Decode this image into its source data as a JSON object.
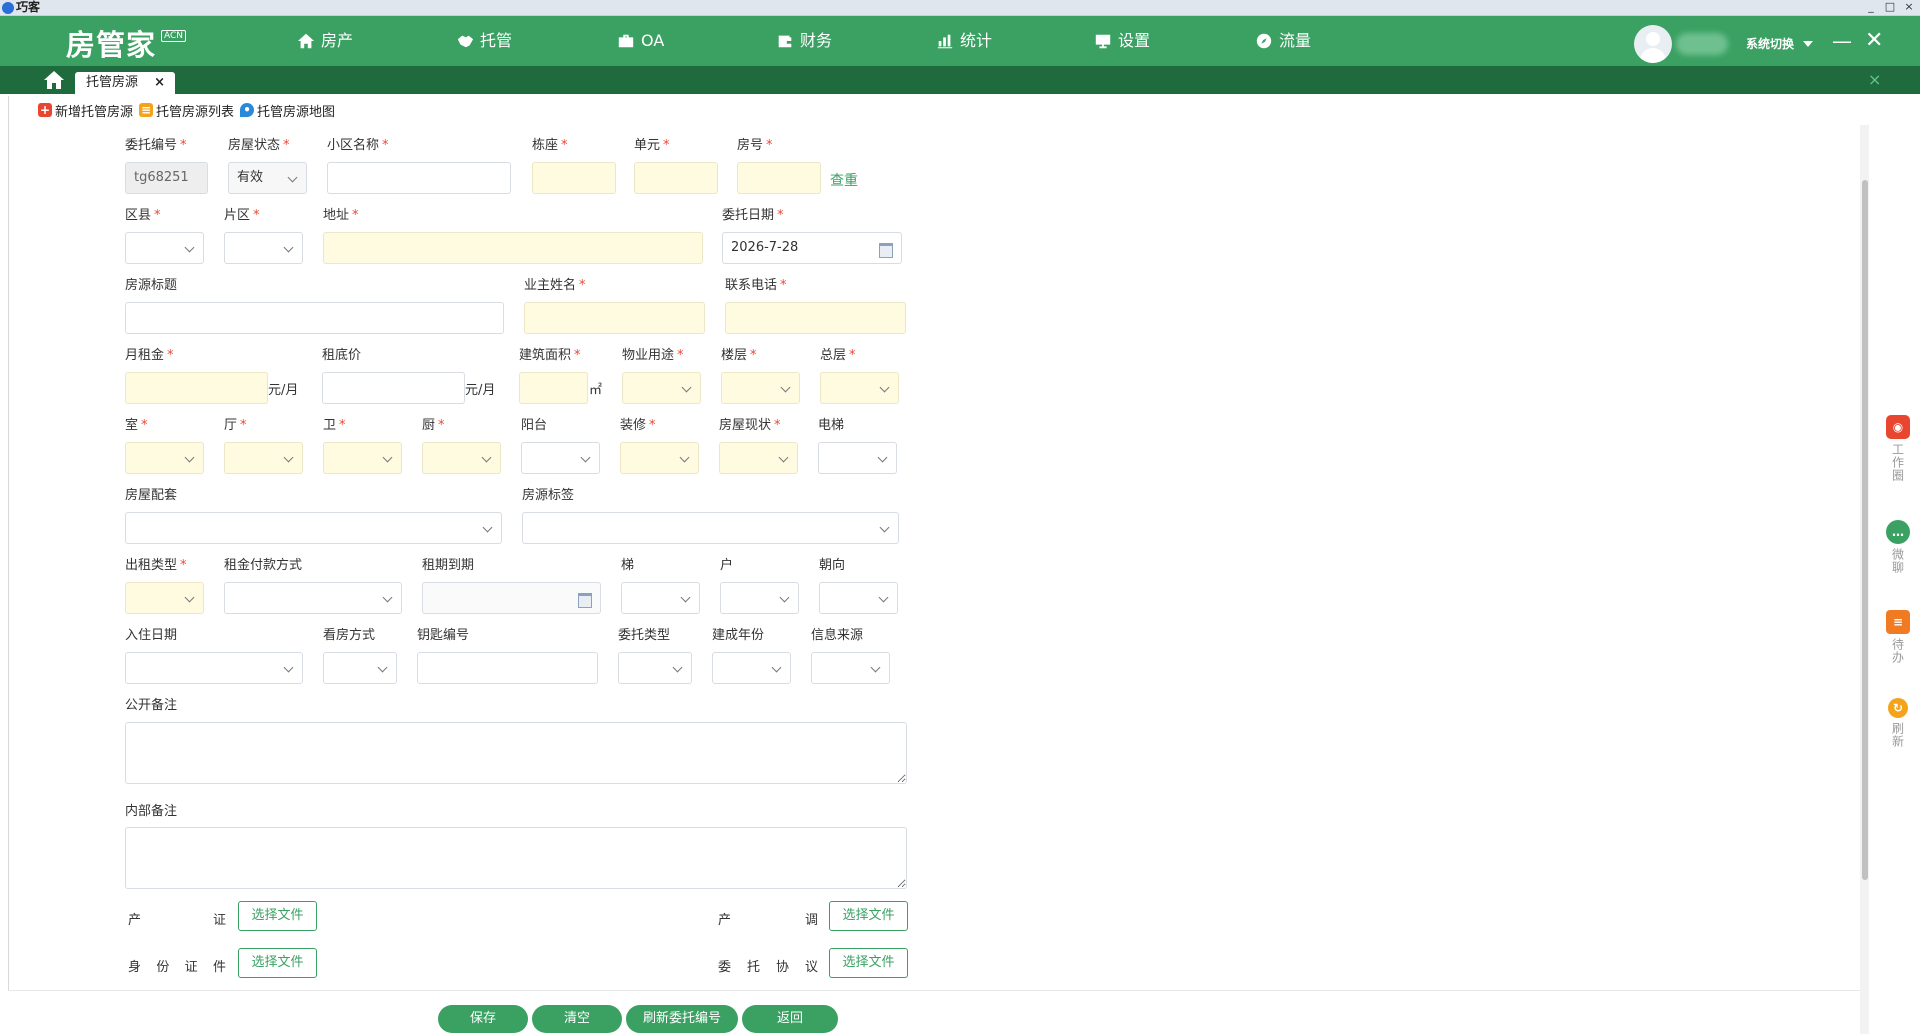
{
  "window": {
    "title": "巧客",
    "controls": [
      "_",
      "□",
      "×"
    ]
  },
  "brand": {
    "name": "房管家",
    "badge": "ACN"
  },
  "nav": [
    {
      "label": "房产",
      "icon": "home-icon"
    },
    {
      "label": "托管",
      "icon": "handshake-icon"
    },
    {
      "label": "OA",
      "icon": "briefcase-icon"
    },
    {
      "label": "财务",
      "icon": "wallet-icon"
    },
    {
      "label": "统计",
      "icon": "chart-icon"
    },
    {
      "label": "设置",
      "icon": "monitor-icon"
    },
    {
      "label": "流量",
      "icon": "compass-icon"
    }
  ],
  "user": {
    "switch_label": "系统切换",
    "minimize": "—",
    "close": "✕"
  },
  "tabs": {
    "active": "托管房源",
    "close": "×",
    "bar_close": "×"
  },
  "toolbar": {
    "add": "新增托管房源",
    "list": "托管房源列表",
    "map": "托管房源地图"
  },
  "form": {
    "entrust_no": {
      "label": "委托编号",
      "value": "tg68251"
    },
    "status": {
      "label": "房屋状态",
      "value": "有效"
    },
    "community": {
      "label": "小区名称",
      "value": ""
    },
    "building": {
      "label": "栋座",
      "value": ""
    },
    "unit": {
      "label": "单元",
      "value": ""
    },
    "room_no": {
      "label": "房号",
      "value": ""
    },
    "check_dup": "查重",
    "district": {
      "label": "区县"
    },
    "area": {
      "label": "片区"
    },
    "address": {
      "label": "地址"
    },
    "entrust_date": {
      "label": "委托日期",
      "value": "2026-7-28"
    },
    "title": {
      "label": "房源标题"
    },
    "owner": {
      "label": "业主姓名"
    },
    "phone": {
      "label": "联系电话"
    },
    "rent": {
      "label": "月租金",
      "unit": "元/月"
    },
    "min_rent": {
      "label": "租底价",
      "unit": "元/月"
    },
    "build_area": {
      "label": "建筑面积",
      "unit": "㎡"
    },
    "usage": {
      "label": "物业用途"
    },
    "floor": {
      "label": "楼层"
    },
    "total_floor": {
      "label": "总层"
    },
    "rooms": {
      "label": "室"
    },
    "halls": {
      "label": "厅"
    },
    "baths": {
      "label": "卫"
    },
    "kitchens": {
      "label": "厨"
    },
    "balcony": {
      "label": "阳台"
    },
    "decoration": {
      "label": "装修"
    },
    "condition": {
      "label": "房屋现状"
    },
    "elevator": {
      "label": "电梯"
    },
    "facilities": {
      "label": "房屋配套"
    },
    "tags": {
      "label": "房源标签"
    },
    "rent_type": {
      "label": "出租类型"
    },
    "pay_method": {
      "label": "租金付款方式"
    },
    "lease_end": {
      "label": "租期到期"
    },
    "stairs": {
      "label": "梯"
    },
    "households": {
      "label": "户"
    },
    "orientation": {
      "label": "朝向"
    },
    "move_in": {
      "label": "入住日期"
    },
    "viewing": {
      "label": "看房方式"
    },
    "key_no": {
      "label": "钥匙编号"
    },
    "entrust_type": {
      "label": "委托类型"
    },
    "built_year": {
      "label": "建成年份"
    },
    "source": {
      "label": "信息来源"
    },
    "public_note": {
      "label": "公开备注"
    },
    "internal_note": {
      "label": "内部备注"
    },
    "property_cert": {
      "label_l": "产",
      "label_r": "证"
    },
    "property_survey": {
      "label_l": "产",
      "label_r": "调"
    },
    "id_doc": {
      "chars": [
        "身",
        "份",
        "证",
        "件"
      ]
    },
    "entrust_agreement": {
      "chars": [
        "委",
        "托",
        "协",
        "议"
      ]
    },
    "choose_file": "选择文件",
    "required_mark": "*"
  },
  "actions": {
    "save": "保存",
    "clear": "清空",
    "refresh_no": "刷新委托编号",
    "back": "返回"
  },
  "side_tools": [
    {
      "label": "工作圈",
      "icon": "camera-icon",
      "color": "#e8462f"
    },
    {
      "label": "微聊",
      "icon": "chat-icon",
      "color": "#3aa163"
    },
    {
      "label": "待办",
      "icon": "todo-icon",
      "color": "#f07b22"
    },
    {
      "label": "刷新",
      "icon": "refresh-icon",
      "color": "#f3a41a"
    }
  ],
  "colors": {
    "primary": "#3aa163",
    "dark": "#1f6b3d",
    "required_bg": "#fffbe0"
  }
}
